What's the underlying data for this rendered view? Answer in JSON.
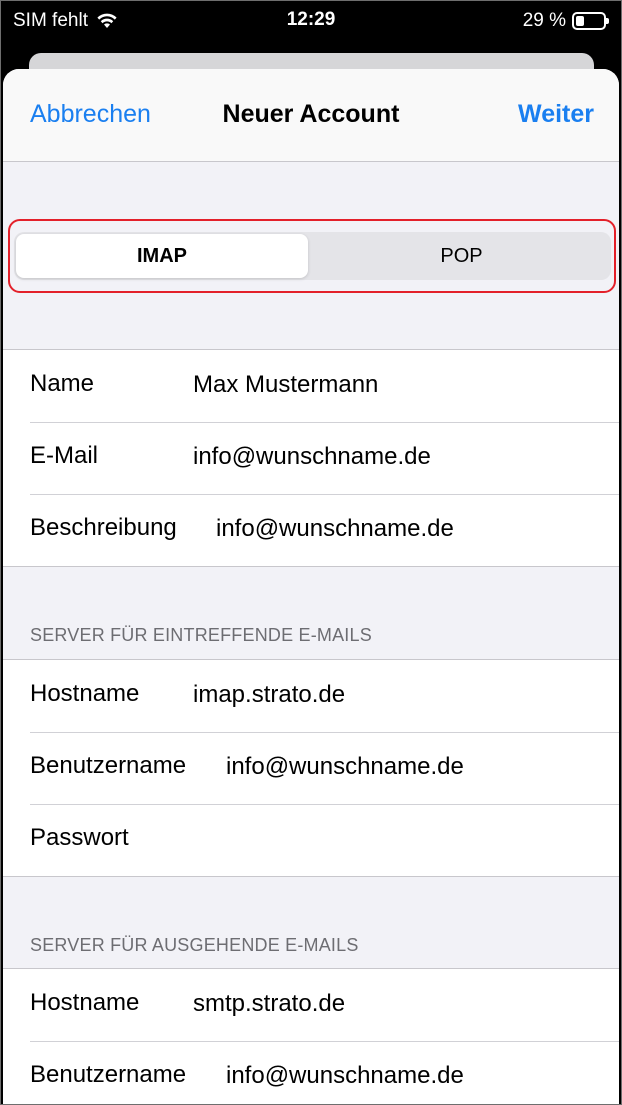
{
  "status_bar": {
    "carrier": "SIM fehlt",
    "time": "12:29",
    "battery_percent": "29 %",
    "battery_level": 0.29
  },
  "nav": {
    "cancel": "Abbrechen",
    "title": "Neuer Account",
    "next": "Weiter"
  },
  "segmented": {
    "options": [
      "IMAP",
      "POP"
    ],
    "selected": "IMAP"
  },
  "account": {
    "rows": [
      {
        "label": "Name",
        "value": "Max Mustermann"
      },
      {
        "label": "E-Mail",
        "value": "info@wunschname.de"
      },
      {
        "label": "Beschreibung",
        "value": "info@wunschname.de"
      }
    ]
  },
  "incoming": {
    "header": "SERVER FÜR EINTREFFENDE E-MAILS",
    "rows": [
      {
        "label": "Hostname",
        "value": "imap.strato.de"
      },
      {
        "label": "Benutzername",
        "value": "info@wunschname.de"
      },
      {
        "label": "Passwort",
        "value": ""
      }
    ]
  },
  "outgoing": {
    "header": "SERVER FÜR AUSGEHENDE E-MAILS",
    "rows": [
      {
        "label": "Hostname",
        "value": "smtp.strato.de"
      },
      {
        "label": "Benutzername",
        "value": "info@wunschname.de"
      }
    ]
  },
  "colors": {
    "accent": "#1a7ff0",
    "highlight": "#e3202a",
    "grouped_bg": "#f2f2f7"
  }
}
